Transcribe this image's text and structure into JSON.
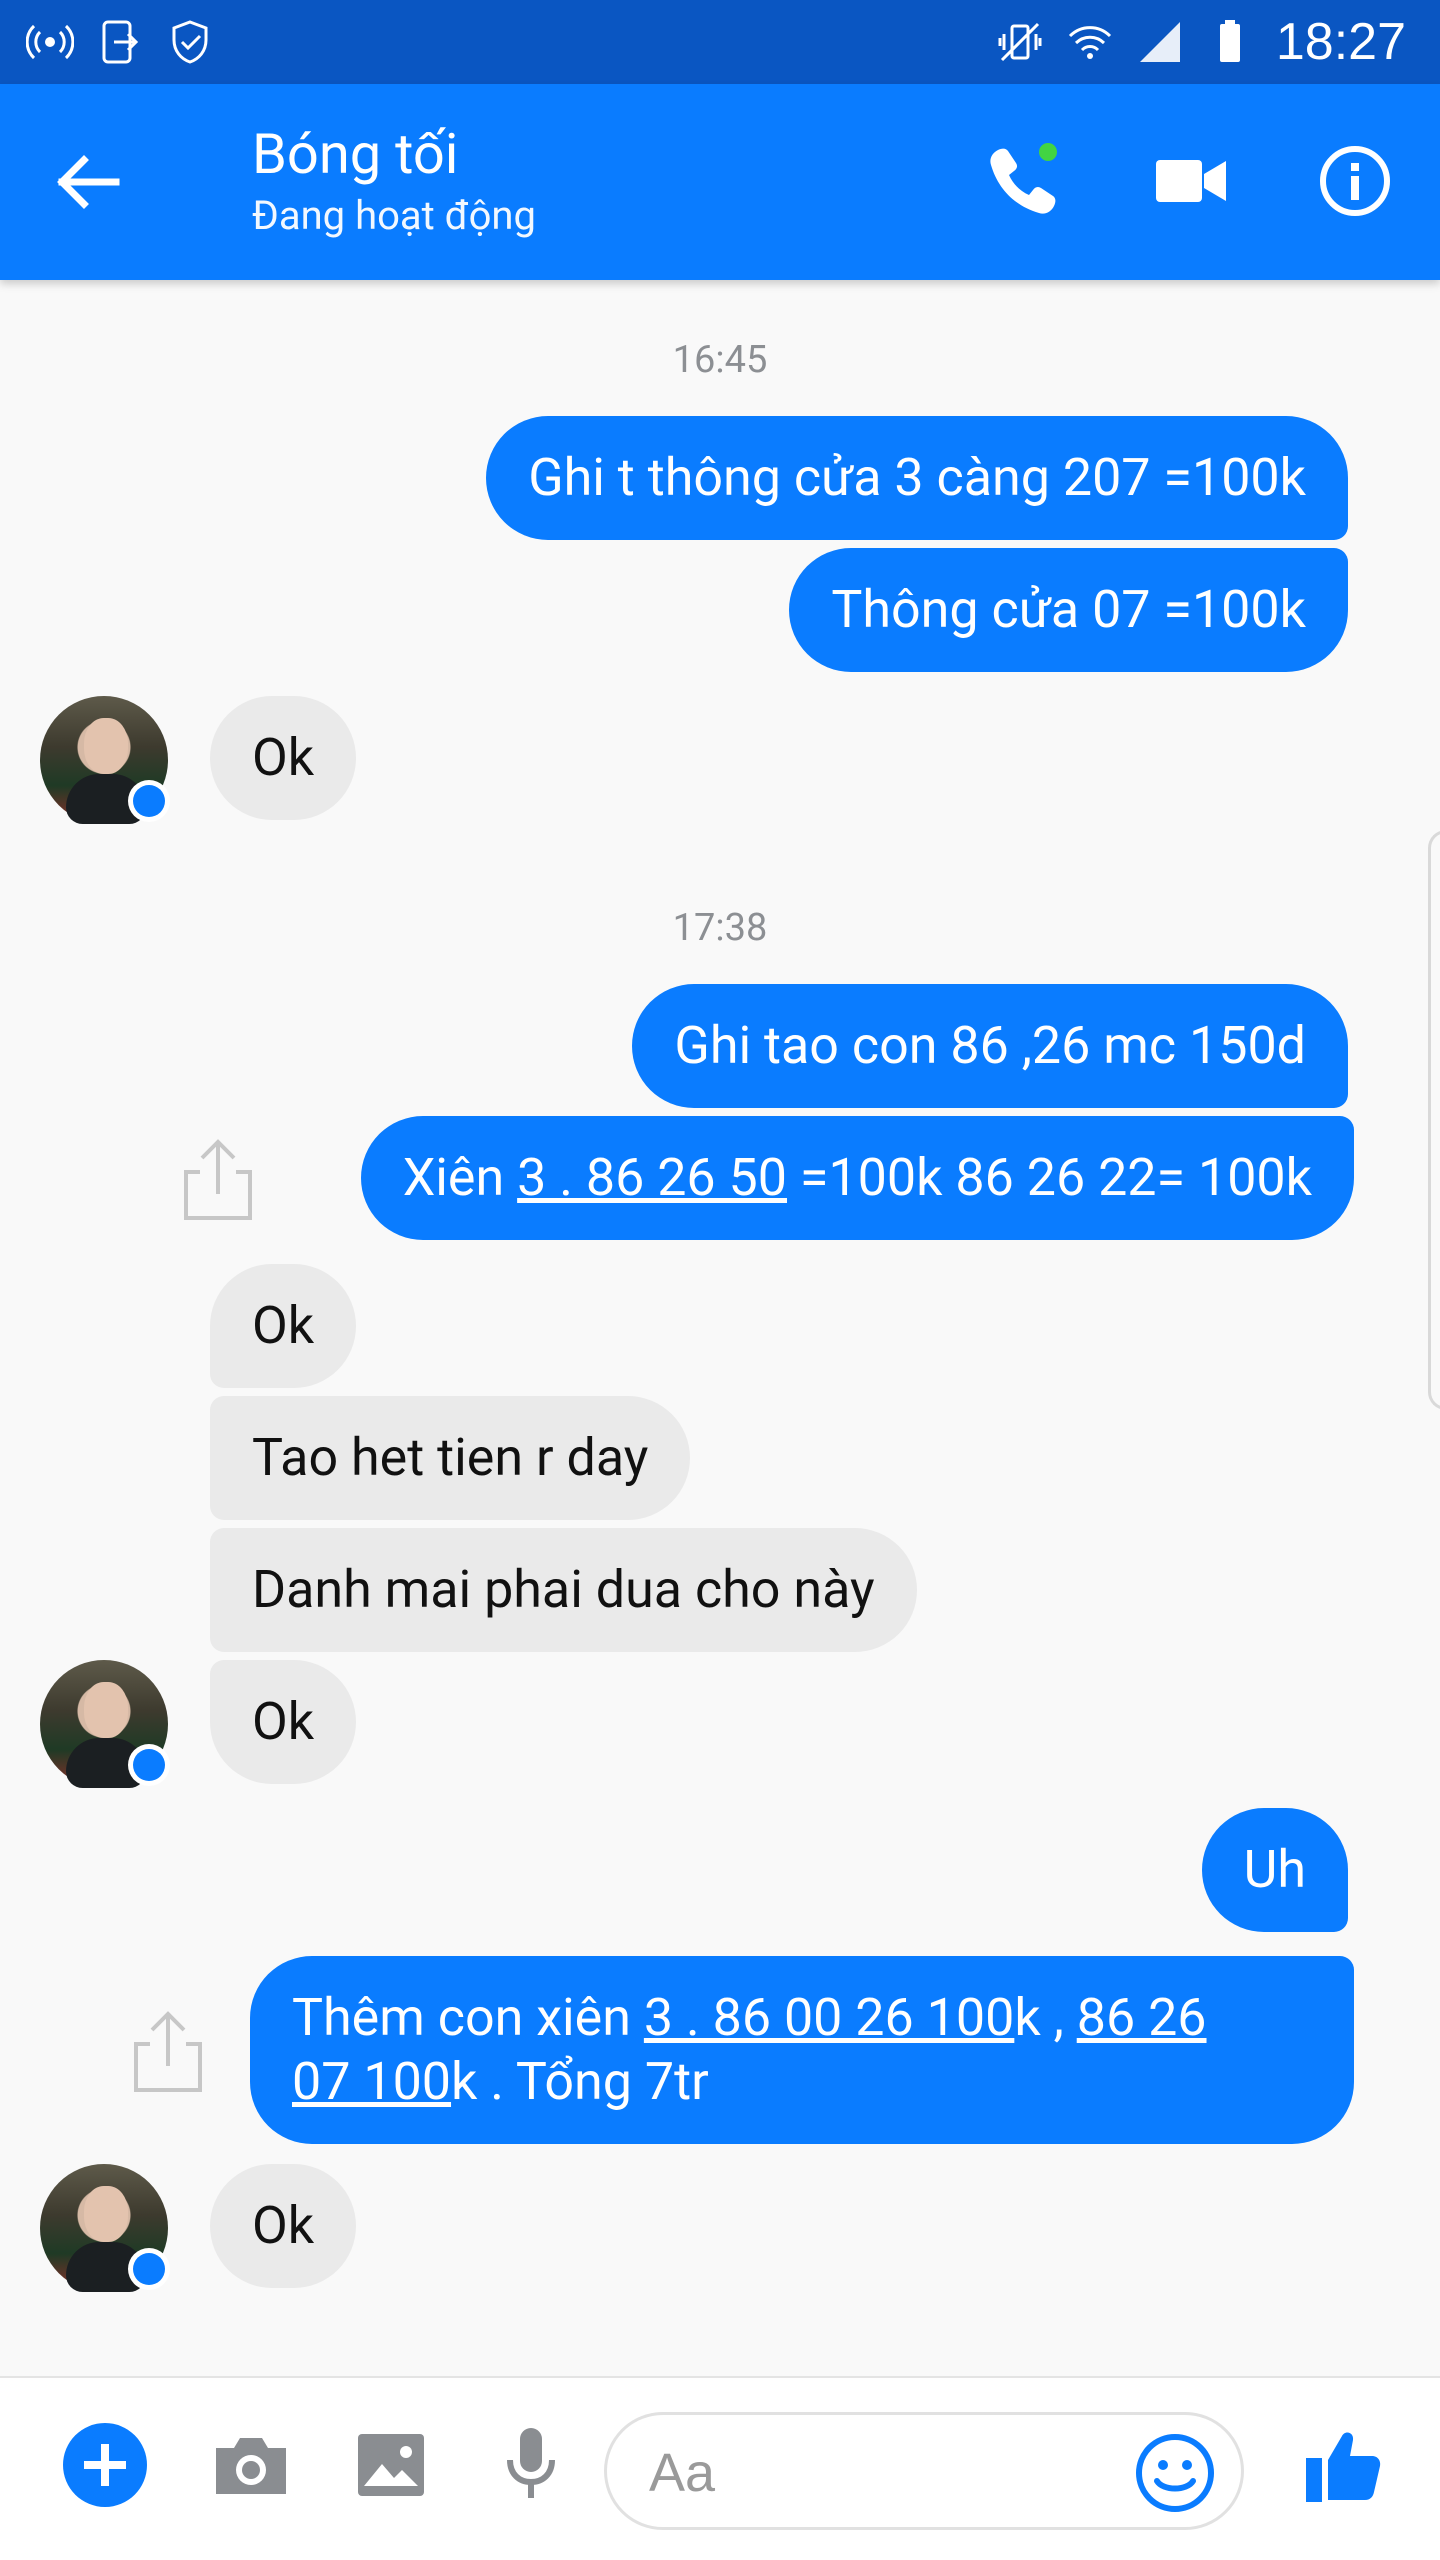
{
  "status_bar": {
    "time": "18:27"
  },
  "header": {
    "name": "Bóng tối",
    "status": "Đang hoạt động"
  },
  "conversation": {
    "timestamp_1": "16:45",
    "timestamp_2": "17:38",
    "out_1": "Ghi t thông cửa 3 càng 207 =100k",
    "out_2": "Thông cửa 07 =100k",
    "in_1": "Ok",
    "out_3": "Ghi tao con 86 ,26 mc 150d",
    "out_4_pre": "Xiên ",
    "out_4_link": "3 . 86 26 50",
    "out_4_post": " =100k 86 26 22= 100k",
    "in_2": "Ok",
    "in_3": "Tao het tien r day",
    "in_4": "Danh mai phai dua cho này",
    "in_5": "Ok",
    "out_5": "Uh",
    "out_6_pre": "Thêm con xiên ",
    "out_6_link1": "3 . 86 00 26 100",
    "out_6_mid": "k  , ",
    "out_6_link2": "86 26",
    "out_6_link3": "07 100",
    "out_6_post": "k . Tổng 7tr",
    "in_6": "Ok"
  },
  "composer": {
    "placeholder": "Aa"
  },
  "colors": {
    "accent": "#0a7cff",
    "status_bar": "#0a56c2",
    "incoming_bubble": "#eaeaea",
    "background": "#f9f9f9"
  }
}
